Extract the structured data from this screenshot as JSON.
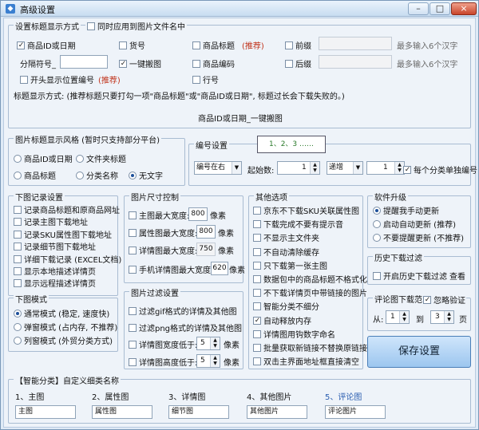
{
  "window": {
    "title": "高级设置",
    "min": "–",
    "max": "□",
    "close": "×",
    "app_icon": "app-icon"
  },
  "title_display": {
    "legend": "设置标题显示方式",
    "apply_to_filename": "同时应用到图片文件名中",
    "opt_product_id_date": "商品ID或日期",
    "opt_item_no": "货号",
    "opt_product_title": "商品标题",
    "recommend": "(推荐)",
    "opt_prefix": "前缀",
    "hint_6chars_1": "最多输入6个汉字",
    "separator_label": "分隔符号_",
    "opt_one_click": "一键搬图",
    "opt_product_code": "商品编码",
    "opt_suffix": "后缀",
    "hint_6chars_2": "最多输入6个汉字",
    "opt_show_number": "开头显示位置编号",
    "recommend2": "(推荐)",
    "opt_line_no": "行号",
    "note": "标题显示方式: (推荐标题只要打勾一项\"商品标题\"或\"商品ID或日期\", 标题过长会下载失败的。)",
    "preview": "商品ID或日期_一键搬图"
  },
  "image_title_style": {
    "legend": "图片标题显示风格 (暂时只支持部分平台)",
    "opt_id_date": "商品ID或日期",
    "opt_folder_title": "文件夹标题",
    "opt_product_title": "商品标题",
    "opt_category_name": "分类名称",
    "opt_no_text": "无文字"
  },
  "numbering": {
    "legend": "编号设置",
    "sequence_preview": "1、2、3 ……",
    "position_value": "编号在右",
    "start_label": "起始数:",
    "start_value": "1",
    "step_value": "递增",
    "step_num": "1",
    "per_category": "每个分类单独编号"
  },
  "download_record": {
    "legend": "下图记录设置",
    "items": [
      "记录商品标题和原商品网址",
      "记录主图下载地址",
      "记录SKU属性图下载地址",
      "记录细节图下载地址",
      "详细下载记录 (EXCEL文档)",
      "显示本地描述详情页",
      "显示远程描述详情页"
    ]
  },
  "download_mode": {
    "legend": "下图模式",
    "items": [
      "通常模式 (稳定, 速度快)",
      "弹窗模式 (占内存, 不推荐)",
      "列窗模式 (外贸分类方式)"
    ]
  },
  "image_size": {
    "legend": "图片尺寸控制",
    "main_width": "主图最大宽度:",
    "main_width_val": "800",
    "unit1": "像素",
    "attr_width": "属性图最大宽度:",
    "attr_width_val": "800",
    "unit2": "像素",
    "detail_width": "详情图最大宽度:",
    "detail_width_val": "750",
    "unit3": "像素",
    "mobile_width": "手机详情图最大宽度:",
    "mobile_width_val": "620",
    "unit4": "像素"
  },
  "image_filter": {
    "legend": "图片过滤设置",
    "filter_gif": "过滤gif格式的详情及其他图",
    "filter_png": "过滤png格式的详情及其他图",
    "detail_width_lt": "详情图宽度低于:",
    "detail_width_val": "5",
    "unit1": "像素",
    "detail_height_lt": "详情图高度低于:",
    "detail_height_val": "5",
    "unit2": "像素"
  },
  "other": {
    "legend": "其他选项",
    "items": [
      "京东不下载SKU关联属性图",
      "下载完成不要有提示音",
      "不显示主文件夹",
      "不自动清除缓存",
      "只下载第一张主图",
      "数据包中的商品标题不格式化",
      "不下载详情页中带链接的图片",
      "智能分类不细分",
      "自动释放内存",
      "详情图用钩数字命名",
      "批量获取新链接不替换原链接",
      "双击主界面地址框直接清空"
    ]
  },
  "upgrade": {
    "legend": "软件升级",
    "items": [
      "提醒我手动更新",
      "启动自动更新 (推荐)",
      "不要提醒更新 (不推荐)"
    ]
  },
  "history_filter": {
    "legend": "历史下载过滤",
    "enable": "开启历史下载过滤",
    "view": "查看"
  },
  "comment_range": {
    "legend": "评论图下载范围",
    "ignore_verify": "忽略验证",
    "from": "从:",
    "from_val": "1",
    "to": "到",
    "to_val": "3",
    "page": "页"
  },
  "save_button": "保存设置",
  "smart_category": {
    "legend": "【智能分类】自定义细类名称",
    "labels": [
      "1、主图",
      "2、属性图",
      "3、详情图",
      "4、其他图片",
      "5、评论图"
    ],
    "values": [
      "主图",
      "属性图",
      "细节图",
      "其他图片",
      "评论图片"
    ]
  }
}
